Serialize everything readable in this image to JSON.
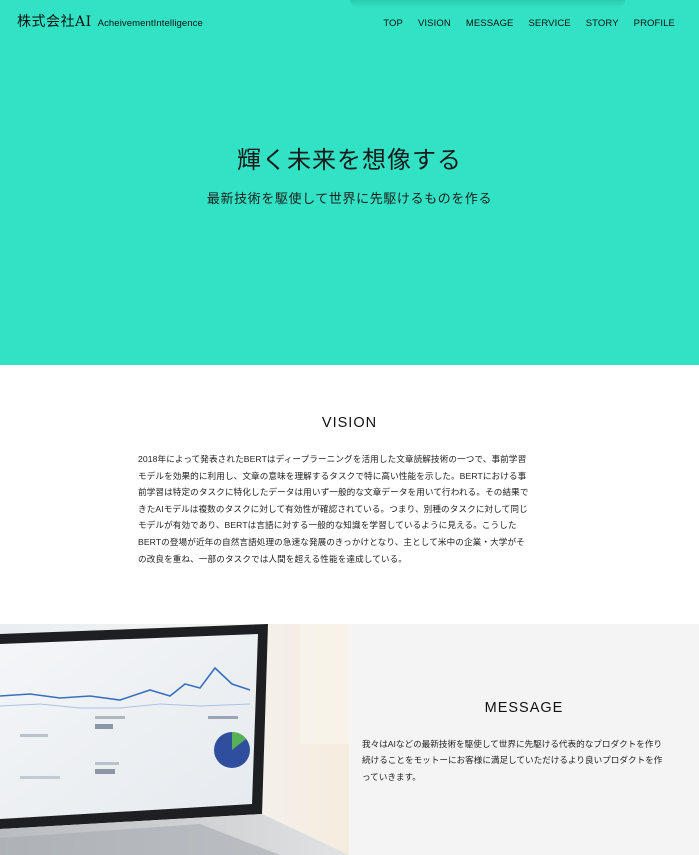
{
  "header": {
    "logo_main": "株式会社AI",
    "logo_sub": "AcheivementIntelligence",
    "nav": [
      "TOP",
      "VISION",
      "MESSAGE",
      "SERVICE",
      "STORY",
      "PROFILE"
    ]
  },
  "hero": {
    "title": "輝く未来を想像する",
    "subtitle": "最新技術を駆使して世界に先駆けるものを作る",
    "background_color": "#31e2c4"
  },
  "vision": {
    "title": "VISION",
    "lines": [
      "2018年によって発表されたBERTはディープラーニングを活用した文章読解技術の一つで、事前学習",
      "モデルを効果的に利用し、文章の意味を理解するタスクで特に高い性能を示した。BERTにおける事",
      "前学習は特定のタスクに特化したデータは用いず一般的な文章データを用いて行われる。その結果で",
      "きたAIモデルは複数のタスクに対して有効性が確認されている。つまり、別種のタスクに対して同じ",
      "モデルが有効であり、BERTは言語に対する一般的な知識を学習しているように見える。こうした",
      "BERTの登場が近年の自然言語処理の急速な発展のきっかけとなり、主として米中の企業・大学がそ",
      "の改良を重ね、一部のタスクでは人間を超える性能を達成している。"
    ]
  },
  "message": {
    "title": "MESSAGE",
    "lines": [
      "我々はAIなどの最新技術を駆使して世界に先駆ける代表的なプロダクトを作り",
      "続けることをモットーにお客様に満足していただけるより良いプロダクトを作",
      "っていきます。"
    ]
  }
}
